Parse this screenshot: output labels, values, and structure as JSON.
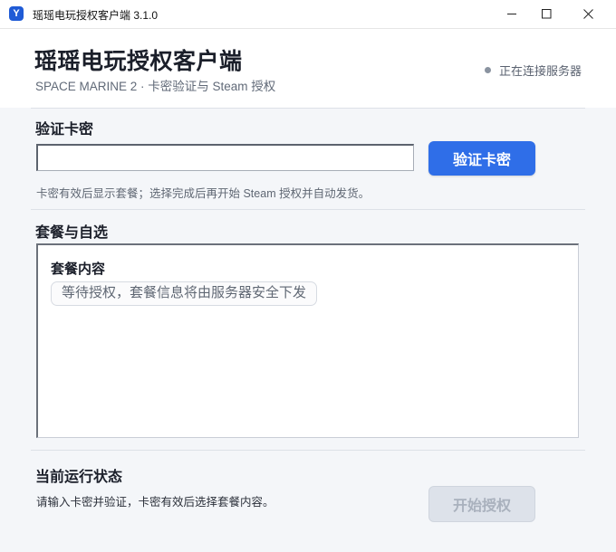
{
  "window": {
    "title": "瑶瑶电玩授权客户端 3.1.0",
    "icon_letter": "Y",
    "controls": [
      "minimize-icon",
      "maximize-icon",
      "close-icon"
    ]
  },
  "header": {
    "title": "瑶瑶电玩授权客户端",
    "subtitle": "SPACE MARINE 2 · 卡密验证与 Steam 授权",
    "connection_status": "正在连接服务器"
  },
  "verify_section": {
    "title": "验证卡密",
    "input_value": "",
    "input_placeholder": "",
    "button_label": "验证卡密",
    "hint": "卡密有效后显示套餐；选择完成后再开始 Steam 授权并自动发货。"
  },
  "package_section": {
    "title": "套餐与自选",
    "panel_heading": "套餐内容",
    "waiting_text": "等待授权，套餐信息将由服务器安全下发"
  },
  "status_section": {
    "title": "当前运行状态",
    "message": "请输入卡密并验证，卡密有效后选择套餐内容。",
    "start_button_label": "开始授权",
    "start_button_enabled": false
  },
  "colors": {
    "accent": "#2f6ee8",
    "disabled_button": "#dde2ea",
    "content_background": "#f4f6f9"
  }
}
